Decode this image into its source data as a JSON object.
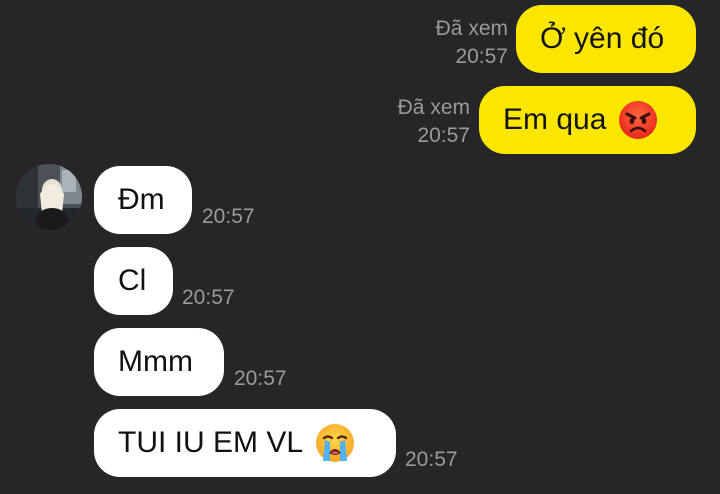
{
  "messages": {
    "out1": {
      "text": "Ở yên đó",
      "seen": "Đã xem",
      "time": "20:57"
    },
    "out2": {
      "text": "Em qua",
      "emoji": "angry-face-icon",
      "seen": "Đã xem",
      "time": "20:57"
    },
    "in1": {
      "text": "Đm",
      "time": "20:57"
    },
    "in2": {
      "text": "Cl",
      "time": "20:57"
    },
    "in3": {
      "text": "Mmm",
      "time": "20:57"
    },
    "in4": {
      "text": "TUI IU EM VL",
      "emoji": "loudly-crying-face-icon",
      "time": "20:57"
    }
  },
  "colors": {
    "background": "#262629",
    "outgoing_bubble": "#fbe600",
    "incoming_bubble": "#ffffff",
    "meta_text": "#9a9a9e"
  }
}
